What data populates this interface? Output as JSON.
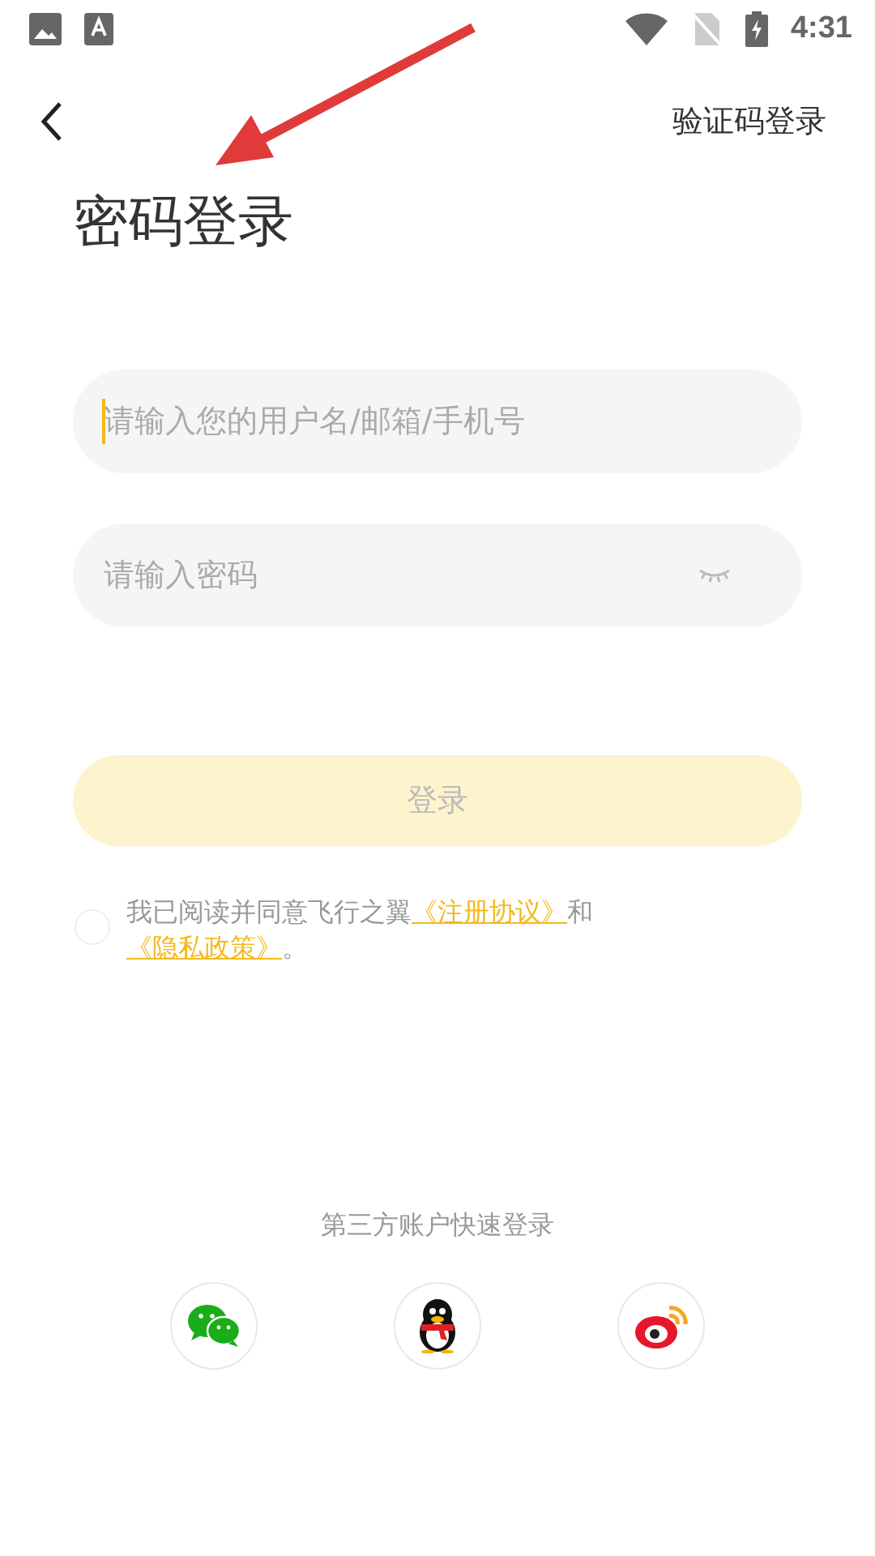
{
  "status_bar": {
    "time": "4:31"
  },
  "nav": {
    "action": "验证码登录"
  },
  "title": "密码登录",
  "fields": [
    {
      "kind": "text",
      "placeholder": "请输入您的用户名/邮箱/手机号",
      "focused": true
    },
    {
      "kind": "password",
      "placeholder": "请输入密码",
      "focused": false
    }
  ],
  "login_button": {
    "label": "登录",
    "disabled": true
  },
  "agreement": {
    "checked": false,
    "parts": [
      {
        "kind": "text",
        "text": "我已阅读并同意飞行之翼"
      },
      {
        "kind": "link",
        "text": "《注册协议》"
      },
      {
        "kind": "text",
        "text": "和"
      },
      {
        "kind": "link",
        "text": "《隐私政策》"
      },
      {
        "kind": "text",
        "text": "。"
      }
    ]
  },
  "third_party": {
    "label": "第三方账户快速登录",
    "providers": [
      {
        "kind": "wechat"
      },
      {
        "kind": "qq"
      },
      {
        "kind": "weibo"
      }
    ]
  }
}
